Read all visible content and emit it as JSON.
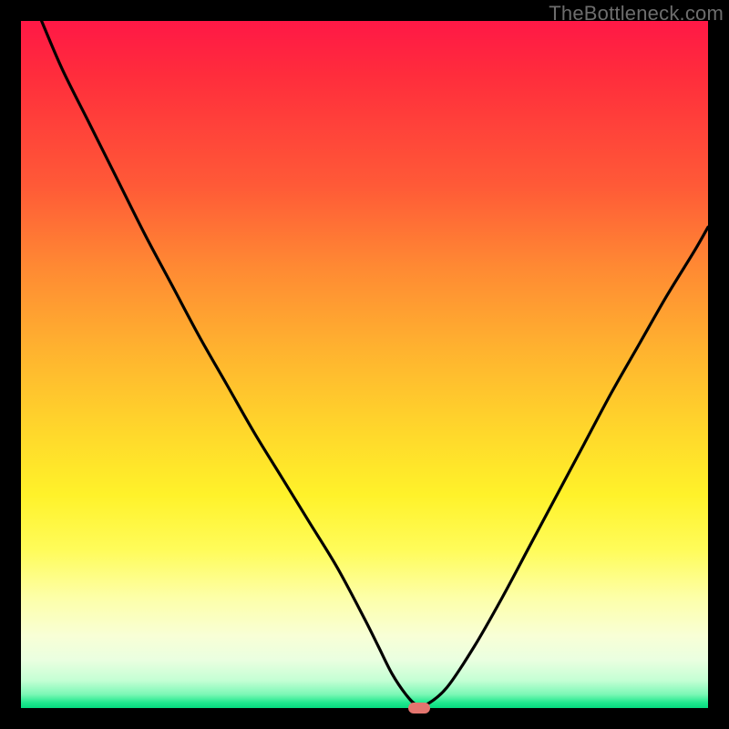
{
  "watermark": "TheBottleneck.com",
  "colors": {
    "frame": "#000000",
    "curve": "#000000",
    "marker": "#e4756f",
    "gradient_top": "#ff1846",
    "gradient_bottom": "#06d97e"
  },
  "chart_data": {
    "type": "line",
    "title": "",
    "xlabel": "",
    "ylabel": "",
    "xlim": [
      0,
      100
    ],
    "ylim": [
      0,
      100
    ],
    "grid": false,
    "series": [
      {
        "name": "bottleneck-curve",
        "x": [
          3,
          6,
          10,
          14,
          18,
          22,
          26,
          30,
          34,
          38,
          42,
          46,
          50,
          52,
          54,
          56,
          57.5,
          59,
          62,
          66,
          70,
          74,
          78,
          82,
          86,
          90,
          94,
          98,
          100
        ],
        "y": [
          100,
          93,
          85,
          77,
          69,
          61.5,
          54,
          47,
          40,
          33.5,
          27,
          20.5,
          13,
          9,
          5,
          2,
          0.5,
          0.5,
          3,
          9,
          16,
          23.5,
          31,
          38.5,
          46,
          53,
          60,
          66.5,
          70
        ]
      }
    ],
    "marker": {
      "x": 58,
      "y": 0,
      "w": 3.2,
      "h": 1.6
    },
    "annotations": []
  }
}
